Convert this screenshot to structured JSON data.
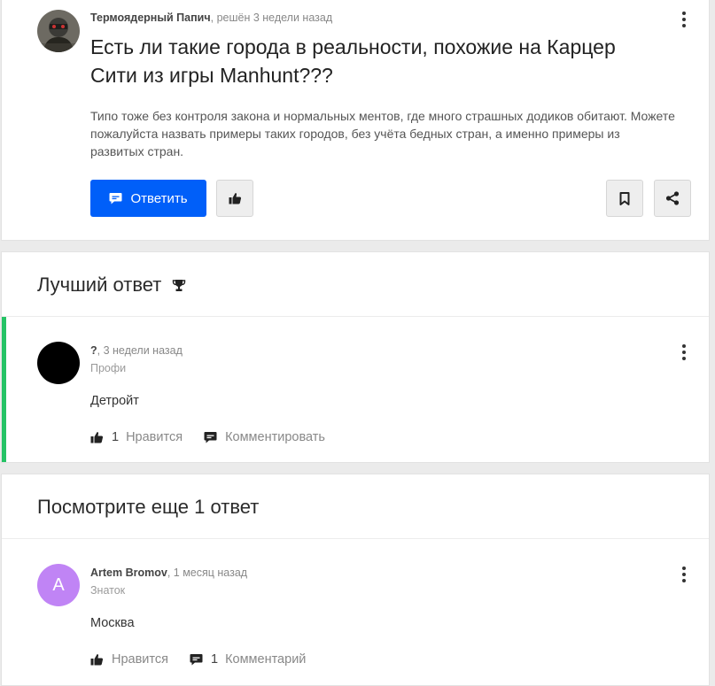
{
  "question": {
    "author": "Термоядерный Папич",
    "status": ", решён 3 недели назад",
    "title": "Есть ли такие города в реальности, похожие на Карцер Сити из игры Manhunt???",
    "body": "Типо тоже без контроля закона и нормальных ментов, где много страшных додиков обитают. Можете пожалуйста назвать примеры таких городов, без учёта бедных стран, а именно примеры из развитых стран.",
    "reply_label": "Ответить",
    "icons": {
      "reply": "chat-icon",
      "like": "thumbs-up-icon",
      "bookmark": "bookmark-icon",
      "share": "share-icon",
      "menu": "more-vertical-icon"
    }
  },
  "best_answer": {
    "section_title": "Лучший ответ",
    "section_icon": "trophy-icon",
    "accent_color": "#25c365",
    "author": "?",
    "time": ", 3 недели назад",
    "rank": "Профи",
    "text": "Детройт",
    "likes_count": "1",
    "like_label": "Нравится",
    "comment_label": "Комментировать"
  },
  "more_answers": {
    "section_title": "Посмотрите еще 1 ответ",
    "items": [
      {
        "avatar_letter": "A",
        "avatar_color": "#c084f5",
        "author": "Artem Bromov",
        "time": ", 1 месяц назад",
        "rank": "Знаток",
        "text": "Москва",
        "like_label": "Нравится",
        "comments_count": "1",
        "comment_label": "Комментарий"
      }
    ]
  },
  "colors": {
    "primary": "#005ff9",
    "page_bg": "#ebebeb"
  }
}
